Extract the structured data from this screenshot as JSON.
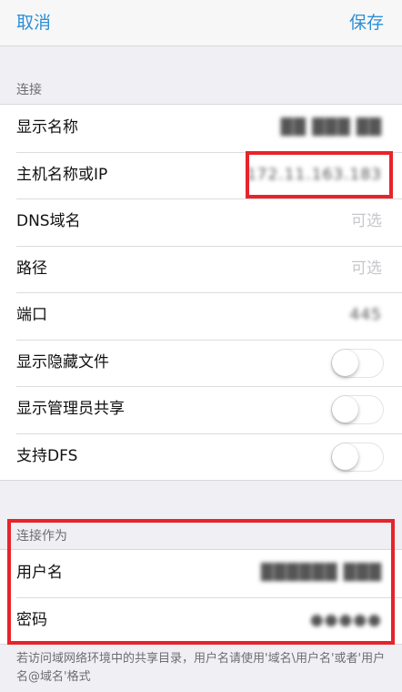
{
  "nav": {
    "cancel_label": "取消",
    "save_label": "保存"
  },
  "connection": {
    "header": "连接",
    "rows": [
      {
        "label": "显示名称",
        "value": "██ ███ ██"
      },
      {
        "label": "主机名称或IP",
        "value": "172.11.163.183"
      },
      {
        "label": "DNS域名",
        "placeholder": "可选"
      },
      {
        "label": "路径",
        "placeholder": "可选"
      },
      {
        "label": "端口",
        "value": "445"
      },
      {
        "label": "显示隐藏文件",
        "toggle": false
      },
      {
        "label": "显示管理员共享",
        "toggle": false
      },
      {
        "label": "支持DFS",
        "toggle": false
      }
    ]
  },
  "connect_as": {
    "header": "连接作为",
    "rows": [
      {
        "label": "用户名",
        "value": "██████ ███"
      },
      {
        "label": "密码",
        "value": "●●●●●"
      }
    ]
  },
  "footer_note": "若访问域网络环境中的共享目录，用户名请使用'域名\\用户名'或者'用户名@域名'格式",
  "colors": {
    "accent": "#2c8fd6",
    "highlight": "#e8232a",
    "background": "#efeff4"
  }
}
